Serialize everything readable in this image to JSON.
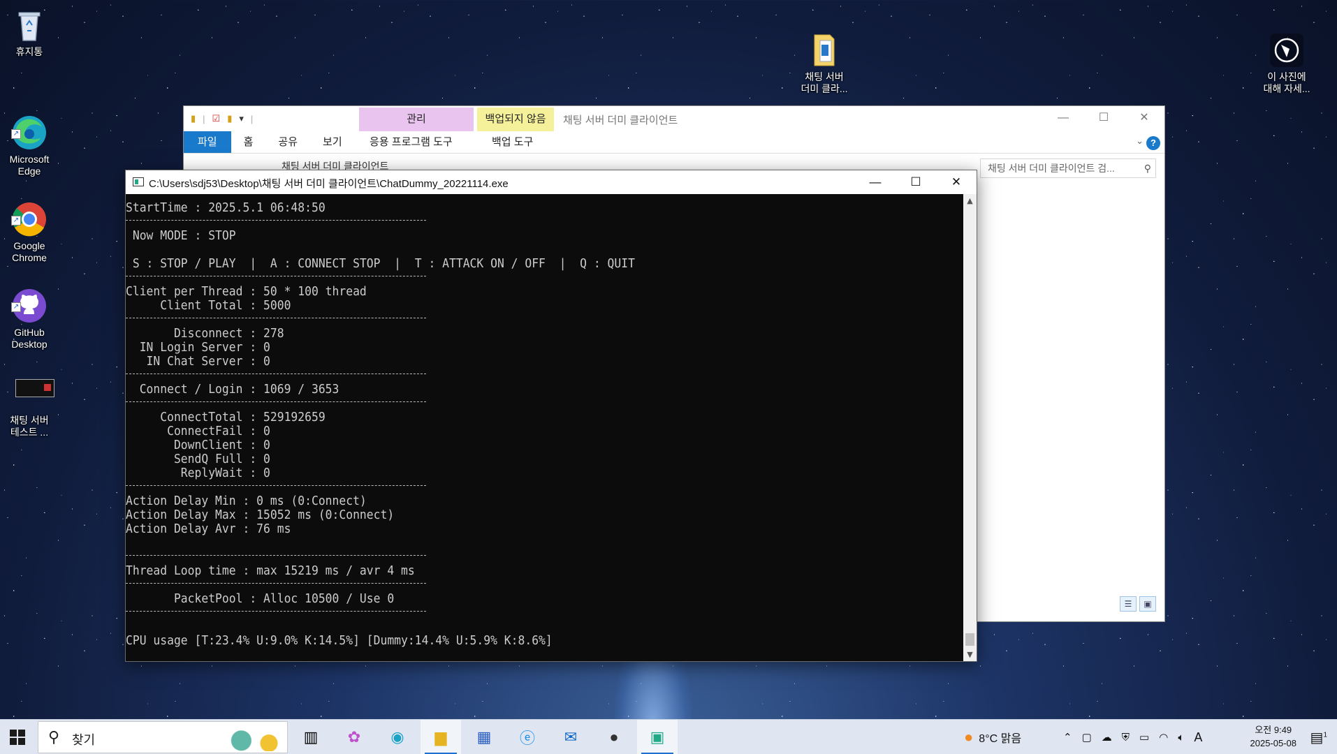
{
  "desktop": {
    "icons": [
      {
        "label": "휴지통",
        "icon": "recycle-bin-icon"
      },
      {
        "label": "Microsoft\nEdge",
        "icon": "edge-icon"
      },
      {
        "label": "Google\nChrome",
        "icon": "chrome-icon"
      },
      {
        "label": "GitHub\nDesktop",
        "icon": "github-icon"
      },
      {
        "label": "채팅 서버\n테스트 ...",
        "icon": "console-shortcut-icon"
      }
    ],
    "folder_icon": {
      "label": "채팅 서버\n더미 클라...",
      "icon": "folder-icon"
    },
    "spotlight": {
      "label": "이 사진에\n대해 자세...",
      "icon": "info-camera-icon"
    }
  },
  "explorer": {
    "window_title": "채팅 서버 더미 클라이언트",
    "context_tab_manage": "관리",
    "context_tab_backup": "백업되지 않음",
    "ribbon_tabs": [
      "파일",
      "홈",
      "공유",
      "보기"
    ],
    "sub_tab_app_tools": "응용 프로그램 도구",
    "sub_tab_backup_tools": "백업 도구",
    "breadcrumb": "채팅 서버 더미 클라이언트",
    "search_placeholder": "채팅 서버 더미 클라이언트 검..."
  },
  "console": {
    "title": "C:\\Users\\sdj53\\Desktop\\채팅 서버 더미 클라이언트\\ChatDummy_20221114.exe",
    "lines": [
      "StartTime : 2025.5.1 06:48:50",
      "---",
      " Now MODE : STOP",
      "",
      " S : STOP / PLAY  |  A : CONNECT STOP  |  T : ATTACK ON / OFF  |  Q : QUIT",
      "---",
      "Client per Thread : 50 * 100 thread",
      "     Client Total : 5000",
      "---",
      "       Disconnect : 278",
      "  IN Login Server : 0",
      "   IN Chat Server : 0",
      "---",
      "  Connect / Login : 1069 / 3653",
      "---",
      "     ConnectTotal : 529192659",
      "      ConnectFail : 0",
      "       DownClient : 0",
      "       SendQ Full : 0",
      "        ReplyWait : 0",
      "---",
      "Action Delay Min : 0 ms (0:Connect)",
      "Action Delay Max : 15052 ms (0:Connect)",
      "Action Delay Avr : 76 ms",
      "",
      "---",
      "Thread Loop time : max 15219 ms / avr 4 ms",
      "---",
      "       PacketPool : Alloc 10500 / Use 0",
      "---",
      "",
      "CPU usage [T:23.4% U:9.0% K:14.5%] [Dummy:14.4% U:5.9% K:8.6%]"
    ]
  },
  "taskbar": {
    "search_text": "찾기",
    "weather": "8°C  맑음",
    "ime": "A",
    "time": "오전 9:49",
    "date": "2025-05-08",
    "notification_count": "1"
  }
}
